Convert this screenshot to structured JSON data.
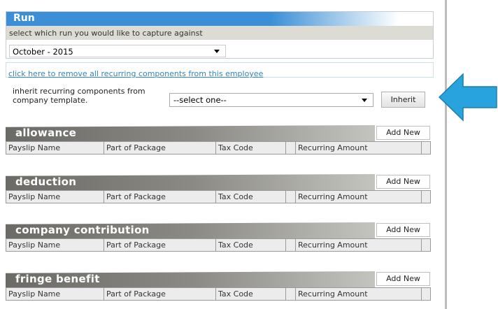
{
  "run": {
    "title": "Run",
    "subtitle": "select which run you would like to capture against",
    "selected": "October - 2015"
  },
  "remove_link": "click here to remove all recurring components from this employee",
  "inherit": {
    "label": "inherit recurring components from company template.",
    "select_value": "--select one--",
    "button": "Inherit"
  },
  "columns": [
    "Payslip Name",
    "Part of Package",
    "Tax Code",
    "",
    "Recurring Amount",
    ""
  ],
  "add_new_label": "Add New",
  "sections": [
    {
      "title": "allowance"
    },
    {
      "title": "deduction"
    },
    {
      "title": "company contribution"
    },
    {
      "title": "fringe benefit"
    }
  ],
  "colors": {
    "accent": "#3a8fd6",
    "arrow": "#29a3dd",
    "header_gray": "#7a7975"
  },
  "icons": {
    "arrow": "arrow-left-icon",
    "dropdown": "chevron-down-icon"
  }
}
